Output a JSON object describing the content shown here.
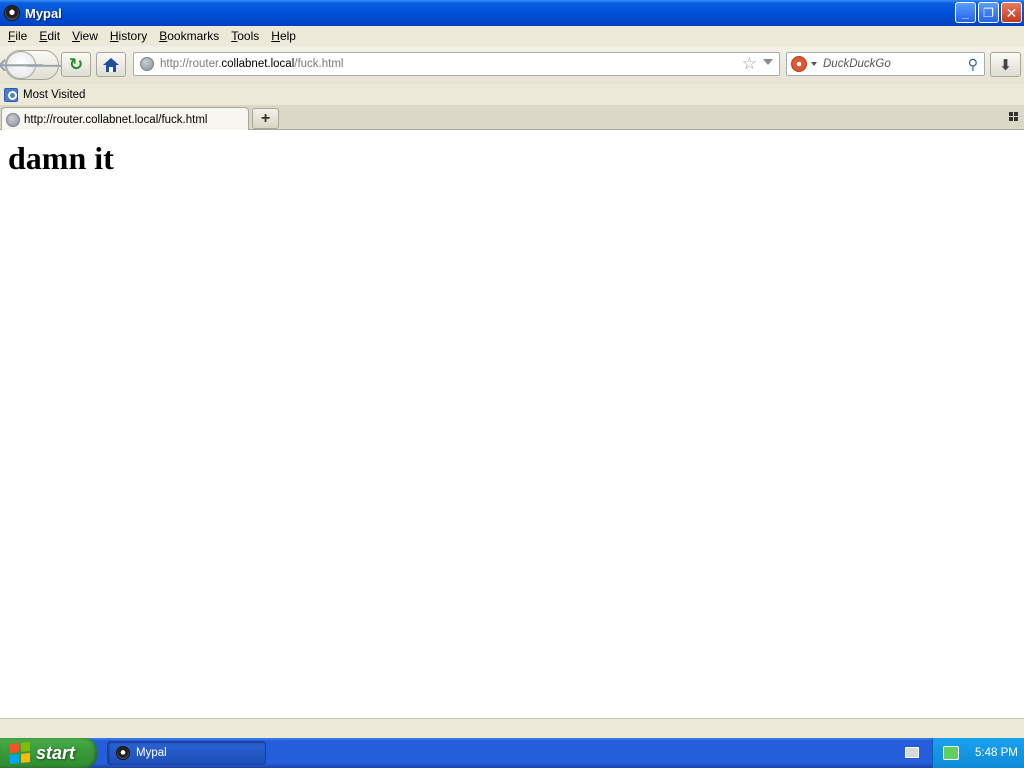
{
  "window": {
    "title": "Mypal",
    "minimize_label": "_",
    "restore_label": "❐",
    "close_label": "✕"
  },
  "menu": {
    "items": [
      {
        "key": "F",
        "rest": "ile"
      },
      {
        "key": "E",
        "rest": "dit"
      },
      {
        "key": "V",
        "rest": "iew"
      },
      {
        "key": "H",
        "rest": "istory"
      },
      {
        "key": "B",
        "rest": "ookmarks"
      },
      {
        "key": "T",
        "rest": "ools"
      },
      {
        "key": "H",
        "rest": "elp"
      }
    ]
  },
  "navbar": {
    "back_glyph": "🡐",
    "forward_glyph": "🡒",
    "reload_glyph": "↻",
    "url_prefix": "http://router.",
    "url_host": "collabnet.local",
    "url_suffix": "/fuck.html",
    "star_glyph": "☆",
    "search_engine": "DuckDuckGo",
    "search_placeholder": "DuckDuckGo",
    "search_go_glyph": "⚲",
    "download_glyph": "⬇"
  },
  "bookmarks": {
    "items": [
      {
        "label": "Most Visited"
      }
    ]
  },
  "tabs": [
    {
      "title": "http://router.collabnet.local/fuck.html",
      "active": true
    }
  ],
  "new_tab_glyph": "+",
  "content": {
    "heading": "damn it"
  },
  "taskbar": {
    "start_label": "start",
    "task_items": [
      {
        "label": "Mypal"
      }
    ],
    "clock": "5:48 PM"
  },
  "colors": {
    "titlebar": "#0050d8",
    "taskbar": "#245edb",
    "start_button": "#3b9b3b",
    "tray": "#1aa1ee",
    "chrome": "#ece9d8"
  }
}
